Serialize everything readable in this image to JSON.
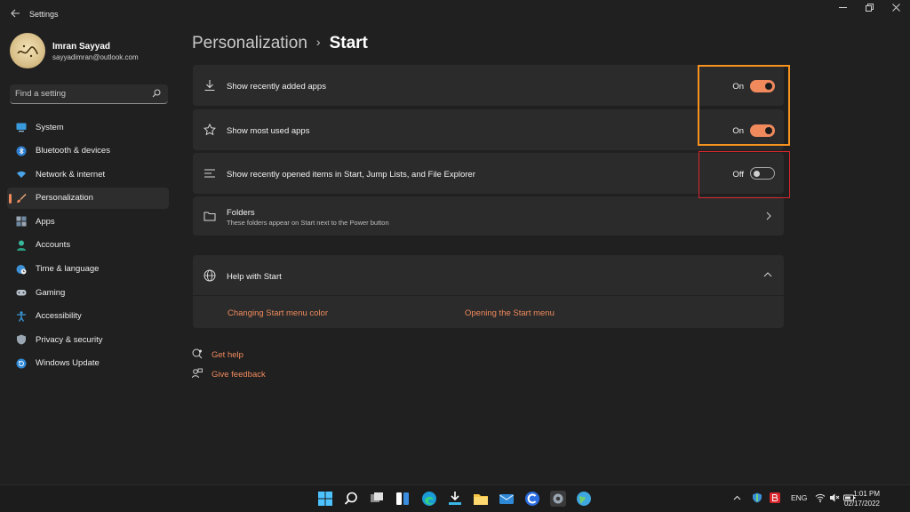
{
  "window": {
    "app_title": "Settings",
    "back_icon": "arrow-left-icon",
    "controls": [
      "minimize-icon",
      "restore-icon",
      "close-icon"
    ]
  },
  "user": {
    "name": "Imran Sayyad",
    "email": "sayyadimran@outlook.com"
  },
  "search": {
    "placeholder": "Find a setting",
    "value": ""
  },
  "sidebar": {
    "items": [
      {
        "label": "System",
        "icon": "monitor-icon",
        "active": false
      },
      {
        "label": "Bluetooth & devices",
        "icon": "bluetooth-icon",
        "active": false
      },
      {
        "label": "Network & internet",
        "icon": "wifi-icon",
        "active": false
      },
      {
        "label": "Personalization",
        "icon": "brush-icon",
        "active": true
      },
      {
        "label": "Apps",
        "icon": "apps-icon",
        "active": false
      },
      {
        "label": "Accounts",
        "icon": "person-icon",
        "active": false
      },
      {
        "label": "Time & language",
        "icon": "globe-clock-icon",
        "active": false
      },
      {
        "label": "Gaming",
        "icon": "gamepad-icon",
        "active": false
      },
      {
        "label": "Accessibility",
        "icon": "accessibility-icon",
        "active": false
      },
      {
        "label": "Privacy & security",
        "icon": "shield-icon",
        "active": false
      },
      {
        "label": "Windows Update",
        "icon": "update-icon",
        "active": false
      }
    ]
  },
  "breadcrumb": {
    "parent": "Personalization",
    "separator": "›",
    "current": "Start"
  },
  "settings": {
    "recent_apps": {
      "label": "Show recently added apps",
      "state": "On",
      "on": true
    },
    "most_used": {
      "label": "Show most used apps",
      "state": "On",
      "on": true
    },
    "recent_items": {
      "label": "Show recently opened items in Start, Jump Lists, and File Explorer",
      "state": "Off",
      "on": false
    },
    "folders": {
      "label": "Folders",
      "description": "These folders appear on Start next to the Power button"
    }
  },
  "help": {
    "title": "Help with Start",
    "links": [
      "Changing Start menu color",
      "Opening the Start menu"
    ]
  },
  "footer_links": {
    "get_help": "Get help",
    "give_feedback": "Give feedback"
  },
  "taskbar": {
    "language": "ENG",
    "time": "1:01 PM",
    "date": "02/17/2022"
  },
  "colors": {
    "accent": "#f08a5d",
    "highlight_orange": "#f7931e",
    "highlight_red": "#d9262c",
    "background": "#202020",
    "card": "#2b2b2b"
  }
}
